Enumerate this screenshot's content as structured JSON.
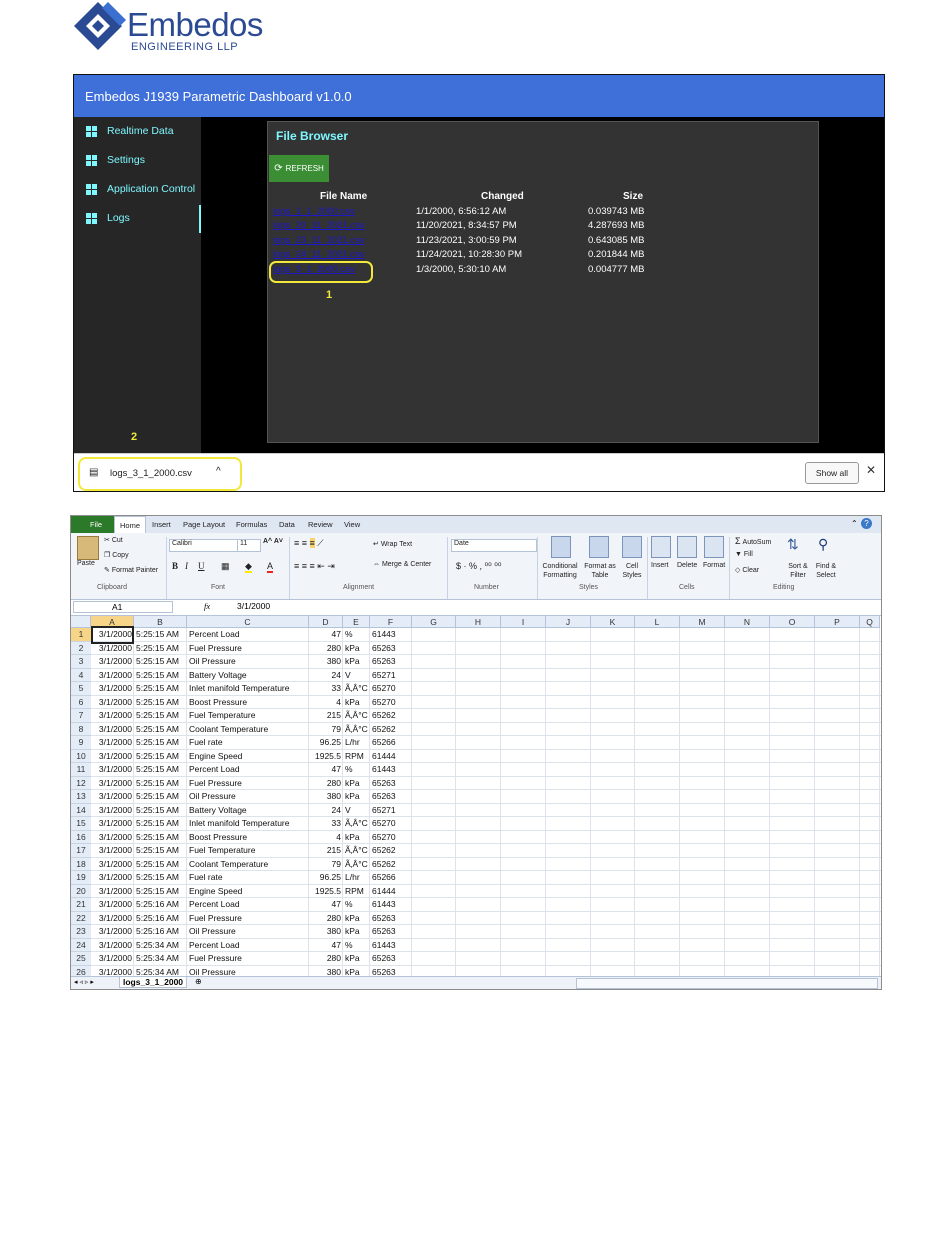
{
  "logo": {
    "name": "Embedos",
    "sub": "ENGINEERING LLP"
  },
  "dashboard": {
    "title": "Embedos J1939 Parametric Dashboard v1.0.0",
    "sidebar": [
      {
        "label": "Realtime Data"
      },
      {
        "label": "Settings"
      },
      {
        "label": "Application Control"
      },
      {
        "label": "Logs"
      }
    ],
    "file_browser": {
      "title": "File Browser",
      "refresh_label": "REFRESH",
      "headers": {
        "name": "File Name",
        "changed": "Changed",
        "size": "Size"
      },
      "rows": [
        {
          "name": "logs_1_1_2000.csv",
          "changed": "1/1/2000, 6:56:12 AM",
          "size": "0.039743 MB"
        },
        {
          "name": "logs_20_11_2021.csv",
          "changed": "11/20/2021, 8:34:57 PM",
          "size": "4.287693 MB"
        },
        {
          "name": "logs_23_11_2021.csv",
          "changed": "11/23/2021, 3:00:59 PM",
          "size": "0.643085 MB"
        },
        {
          "name": "logs_24_11_2021.csv",
          "changed": "11/24/2021, 10:28:30 PM",
          "size": "0.201844 MB"
        },
        {
          "name": "logs_3_1_2000.csv",
          "changed": "1/3/2000, 5:30:10 AM",
          "size": "0.004777 MB"
        }
      ]
    },
    "marker_1": "1",
    "marker_2": "2",
    "download": {
      "file": "logs_3_1_2000.csv",
      "show_all": "Show all",
      "close": "✕"
    },
    "colors": {
      "header": "#3f6fd8",
      "accent": "#7ff7ff",
      "refresh": "#3b8e34",
      "highlight": "#f2e83b"
    }
  },
  "excel": {
    "tabs": [
      "File",
      "Home",
      "Insert",
      "Page Layout",
      "Formulas",
      "Data",
      "Review",
      "View"
    ],
    "ribbon": {
      "clipboard": {
        "paste": "Paste",
        "cut": "Cut",
        "copy": "Copy",
        "format_painter": "Format Painter",
        "group": "Clipboard"
      },
      "font": {
        "name": "Calibri",
        "size": "11",
        "group": "Font"
      },
      "alignment": {
        "wrap": "Wrap Text",
        "merge": "Merge & Center",
        "group": "Alignment"
      },
      "number": {
        "format": "Date",
        "group": "Number"
      },
      "styles": {
        "conditional": "Conditional Formatting",
        "format_table": "Format as Table",
        "cell_styles": "Cell Styles",
        "group": "Styles"
      },
      "cells": {
        "insert": "Insert",
        "delete": "Delete",
        "format": "Format",
        "group": "Cells"
      },
      "editing": {
        "autosum": "AutoSum",
        "fill": "Fill",
        "clear": "Clear",
        "sort": "Sort & Filter",
        "find": "Find & Select",
        "group": "Editing"
      }
    },
    "name_box": "A1",
    "formula": "3/1/2000",
    "columns": [
      "A",
      "B",
      "C",
      "D",
      "E",
      "F",
      "G",
      "H",
      "I",
      "J",
      "K",
      "L",
      "M",
      "N",
      "O",
      "P",
      "Q"
    ],
    "rows": [
      [
        "3/1/2000",
        "5:25:15 AM",
        "Percent Load",
        "47",
        "%",
        "61443"
      ],
      [
        "3/1/2000",
        "5:25:15 AM",
        "Fuel Pressure",
        "280",
        "kPa",
        "65263"
      ],
      [
        "3/1/2000",
        "5:25:15 AM",
        "Oil Pressure",
        "380",
        "kPa",
        "65263"
      ],
      [
        "3/1/2000",
        "5:25:15 AM",
        "Battery Voltage",
        "24",
        "V",
        "65271"
      ],
      [
        "3/1/2000",
        "5:25:15 AM",
        "Inlet manifold Temperature",
        "33",
        "Ã‚Â°C",
        "65270"
      ],
      [
        "3/1/2000",
        "5:25:15 AM",
        "Boost Pressure",
        "4",
        "kPa",
        "65270"
      ],
      [
        "3/1/2000",
        "5:25:15 AM",
        "Fuel Temperature",
        "215",
        "Ã‚Â°C",
        "65262"
      ],
      [
        "3/1/2000",
        "5:25:15 AM",
        "Coolant Temperature",
        "79",
        "Ã‚Â°C",
        "65262"
      ],
      [
        "3/1/2000",
        "5:25:15 AM",
        "Fuel rate",
        "96.25",
        "L/hr",
        "65266"
      ],
      [
        "3/1/2000",
        "5:25:15 AM",
        "Engine Speed",
        "1925.5",
        "RPM",
        "61444"
      ],
      [
        "3/1/2000",
        "5:25:15 AM",
        "Percent Load",
        "47",
        "%",
        "61443"
      ],
      [
        "3/1/2000",
        "5:25:15 AM",
        "Fuel Pressure",
        "280",
        "kPa",
        "65263"
      ],
      [
        "3/1/2000",
        "5:25:15 AM",
        "Oil Pressure",
        "380",
        "kPa",
        "65263"
      ],
      [
        "3/1/2000",
        "5:25:15 AM",
        "Battery Voltage",
        "24",
        "V",
        "65271"
      ],
      [
        "3/1/2000",
        "5:25:15 AM",
        "Inlet manifold Temperature",
        "33",
        "Ã‚Â°C",
        "65270"
      ],
      [
        "3/1/2000",
        "5:25:15 AM",
        "Boost Pressure",
        "4",
        "kPa",
        "65270"
      ],
      [
        "3/1/2000",
        "5:25:15 AM",
        "Fuel Temperature",
        "215",
        "Ã‚Â°C",
        "65262"
      ],
      [
        "3/1/2000",
        "5:25:15 AM",
        "Coolant Temperature",
        "79",
        "Ã‚Â°C",
        "65262"
      ],
      [
        "3/1/2000",
        "5:25:15 AM",
        "Fuel rate",
        "96.25",
        "L/hr",
        "65266"
      ],
      [
        "3/1/2000",
        "5:25:15 AM",
        "Engine Speed",
        "1925.5",
        "RPM",
        "61444"
      ],
      [
        "3/1/2000",
        "5:25:16 AM",
        "Percent Load",
        "47",
        "%",
        "61443"
      ],
      [
        "3/1/2000",
        "5:25:16 AM",
        "Fuel Pressure",
        "280",
        "kPa",
        "65263"
      ],
      [
        "3/1/2000",
        "5:25:16 AM",
        "Oil Pressure",
        "380",
        "kPa",
        "65263"
      ],
      [
        "3/1/2000",
        "5:25:34 AM",
        "Percent Load",
        "47",
        "%",
        "61443"
      ],
      [
        "3/1/2000",
        "5:25:34 AM",
        "Fuel Pressure",
        "280",
        "kPa",
        "65263"
      ],
      [
        "3/1/2000",
        "5:25:34 AM",
        "Oil Pressure",
        "380",
        "kPa",
        "65263"
      ]
    ],
    "sheet_tab": "logs_3_1_2000"
  }
}
